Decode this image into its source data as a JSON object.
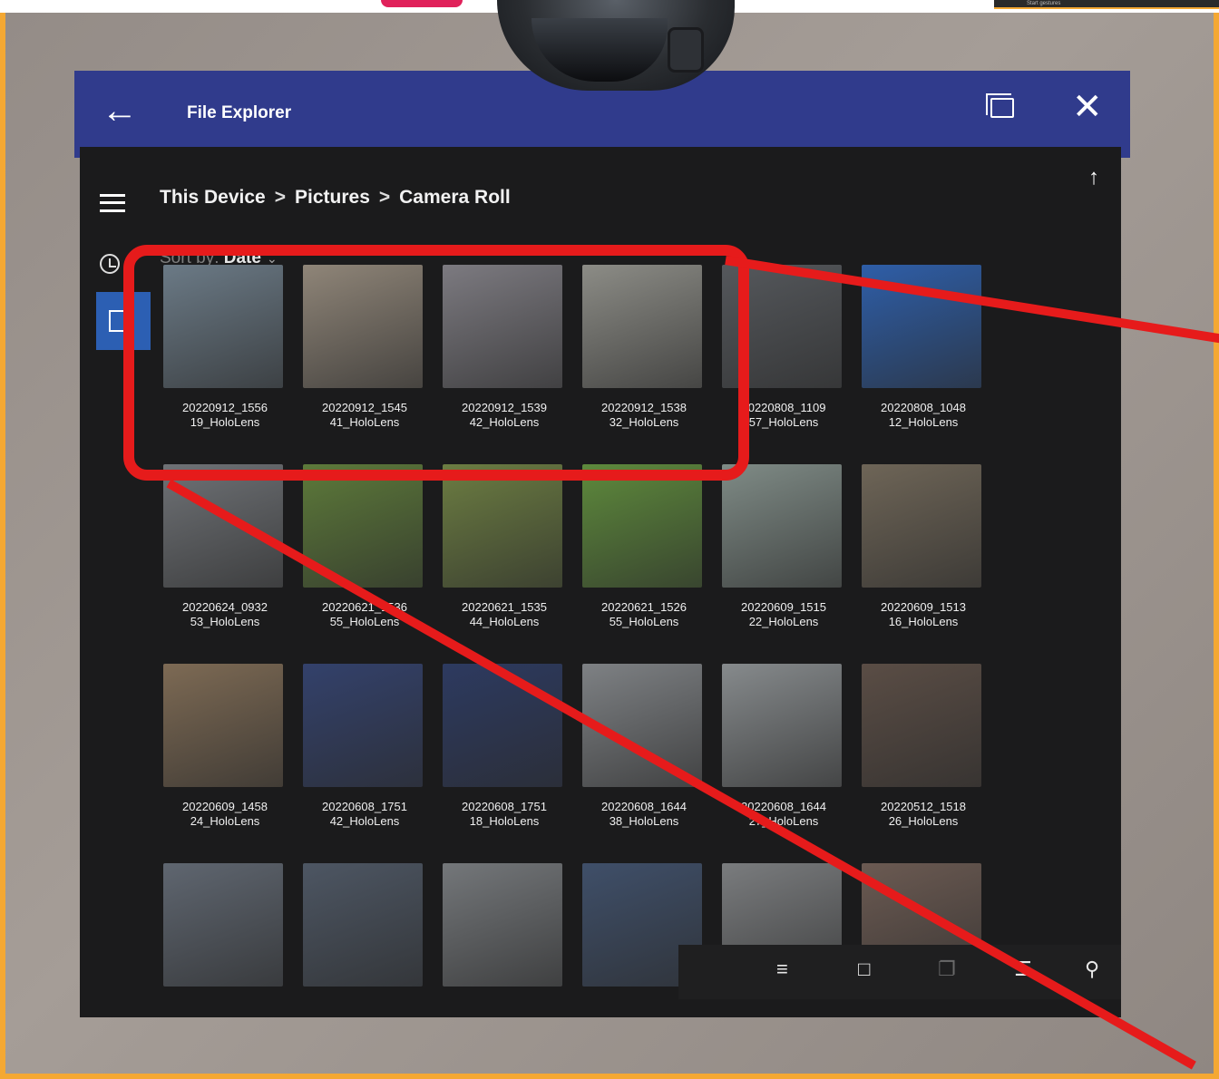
{
  "app": {
    "title": "File Explorer"
  },
  "breadcrumb": [
    "This Device",
    "Pictures",
    "Camera Roll"
  ],
  "breadcrumb_separator": ">",
  "sort": {
    "prefix": "Sort by:",
    "value": "Date"
  },
  "corner_thumb_text": "Start gestures",
  "icons": {
    "back": "back-arrow-icon",
    "snap": "snap-window-icon",
    "close": "close-icon",
    "menu": "hamburger-icon",
    "up": "up-arrow-icon",
    "recent": "clock-icon",
    "multi_select": "multi-select-icon",
    "new_item": "new-item-icon",
    "copy": "copy-icon",
    "view": "list-view-icon",
    "search": "search-icon",
    "more": "more-icon"
  },
  "colors": {
    "titlebar": "#303b8c",
    "highlight": "#e61b1b",
    "accent": "#2c5fb3",
    "frame": "#f4a833"
  },
  "files": [
    {
      "name": "20220912_1556\n19_HoloLens",
      "tone": "#6b7a86"
    },
    {
      "name": "20220912_1545\n41_HoloLens",
      "tone": "#8f8578"
    },
    {
      "name": "20220912_1539\n42_HoloLens",
      "tone": "#7c7a80"
    },
    {
      "name": "20220912_1538\n32_HoloLens",
      "tone": "#8c8c86"
    },
    {
      "name": "20220808_1109\n57_HoloLens",
      "tone": "#55585c"
    },
    {
      "name": "20220808_1048\n12_HoloLens",
      "tone": "#2e5ea8"
    },
    {
      "name": "20220624_0932\n53_HoloLens",
      "tone": "#6f7276"
    },
    {
      "name": "20220621_1536\n55_HoloLens",
      "tone": "#5d7a3a"
    },
    {
      "name": "20220621_1535\n44_HoloLens",
      "tone": "#6c7d42"
    },
    {
      "name": "20220621_1526\n55_HoloLens",
      "tone": "#5e8a3c"
    },
    {
      "name": "20220609_1515\n22_HoloLens",
      "tone": "#7f8b86"
    },
    {
      "name": "20220609_1513\n16_HoloLens",
      "tone": "#6e6557"
    },
    {
      "name": "20220609_1458\n24_HoloLens",
      "tone": "#7d6a54"
    },
    {
      "name": "20220608_1751\n42_HoloLens",
      "tone": "#33416b"
    },
    {
      "name": "20220608_1751\n18_HoloLens",
      "tone": "#2d3a60"
    },
    {
      "name": "20220608_1644\n38_HoloLens",
      "tone": "#7e8184"
    },
    {
      "name": "20220608_1644\n27_HoloLens",
      "tone": "#868a8c"
    },
    {
      "name": "20220512_1518\n26_HoloLens",
      "tone": "#5a4d45"
    },
    {
      "name": "",
      "tone": "#5f6670"
    },
    {
      "name": "",
      "tone": "#4d5663"
    },
    {
      "name": "",
      "tone": "#74777a"
    },
    {
      "name": "",
      "tone": "#3f4f69"
    },
    {
      "name": "",
      "tone": "#7a7c7e"
    },
    {
      "name": "",
      "tone": "#6b5a52"
    }
  ],
  "toolbar": [
    "multi_select",
    "new_item",
    "copy",
    "view",
    "search",
    "more"
  ]
}
